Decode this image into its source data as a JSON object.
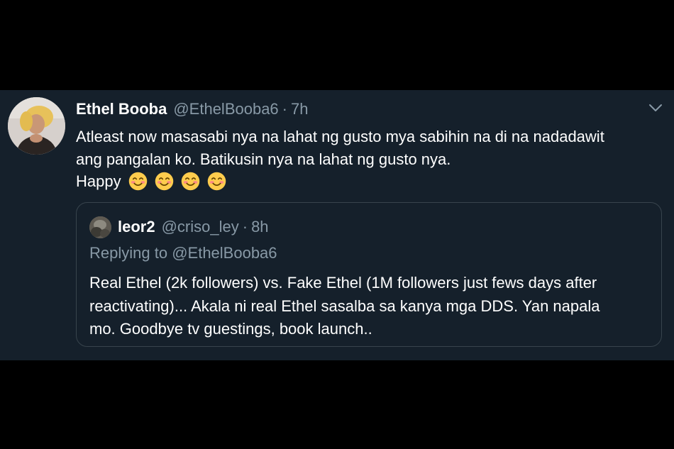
{
  "tweet": {
    "author_name": "Ethel Booba",
    "author_handle": "@EthelBooba6",
    "separator": "·",
    "time": "7h",
    "text_lines": [
      "Atleast now masasabi nya na lahat ng gusto mya sabihin na di na nadadawit",
      "ang pangalan ko. Batikusin nya na lahat ng gusto nya.",
      "Happy"
    ],
    "emojis": [
      "smiling-face-emoji",
      "smiling-face-emoji",
      "smiling-face-emoji",
      "smiling-face-emoji"
    ]
  },
  "quoted_tweet": {
    "author_name": "leor2",
    "author_handle": "@criso_ley",
    "separator": "·",
    "time": "8h",
    "replying_prefix": "Replying to",
    "replying_to": "@EthelBooba6",
    "text_lines": [
      "Real Ethel (2k followers) vs. Fake Ethel (1M followers just fews days after",
      "reactivating)... Akala ni real Ethel sasalba sa kanya mga DDS. Yan napala",
      "mo. Goodbye tv guestings, book launch.."
    ]
  },
  "colors": {
    "background": "#000000",
    "tweet_background": "#15202b",
    "primary_text": "#ffffff",
    "secondary_text": "#8899a6",
    "quote_border": "#38444d",
    "emoji_fill": "#ffcc4d"
  }
}
